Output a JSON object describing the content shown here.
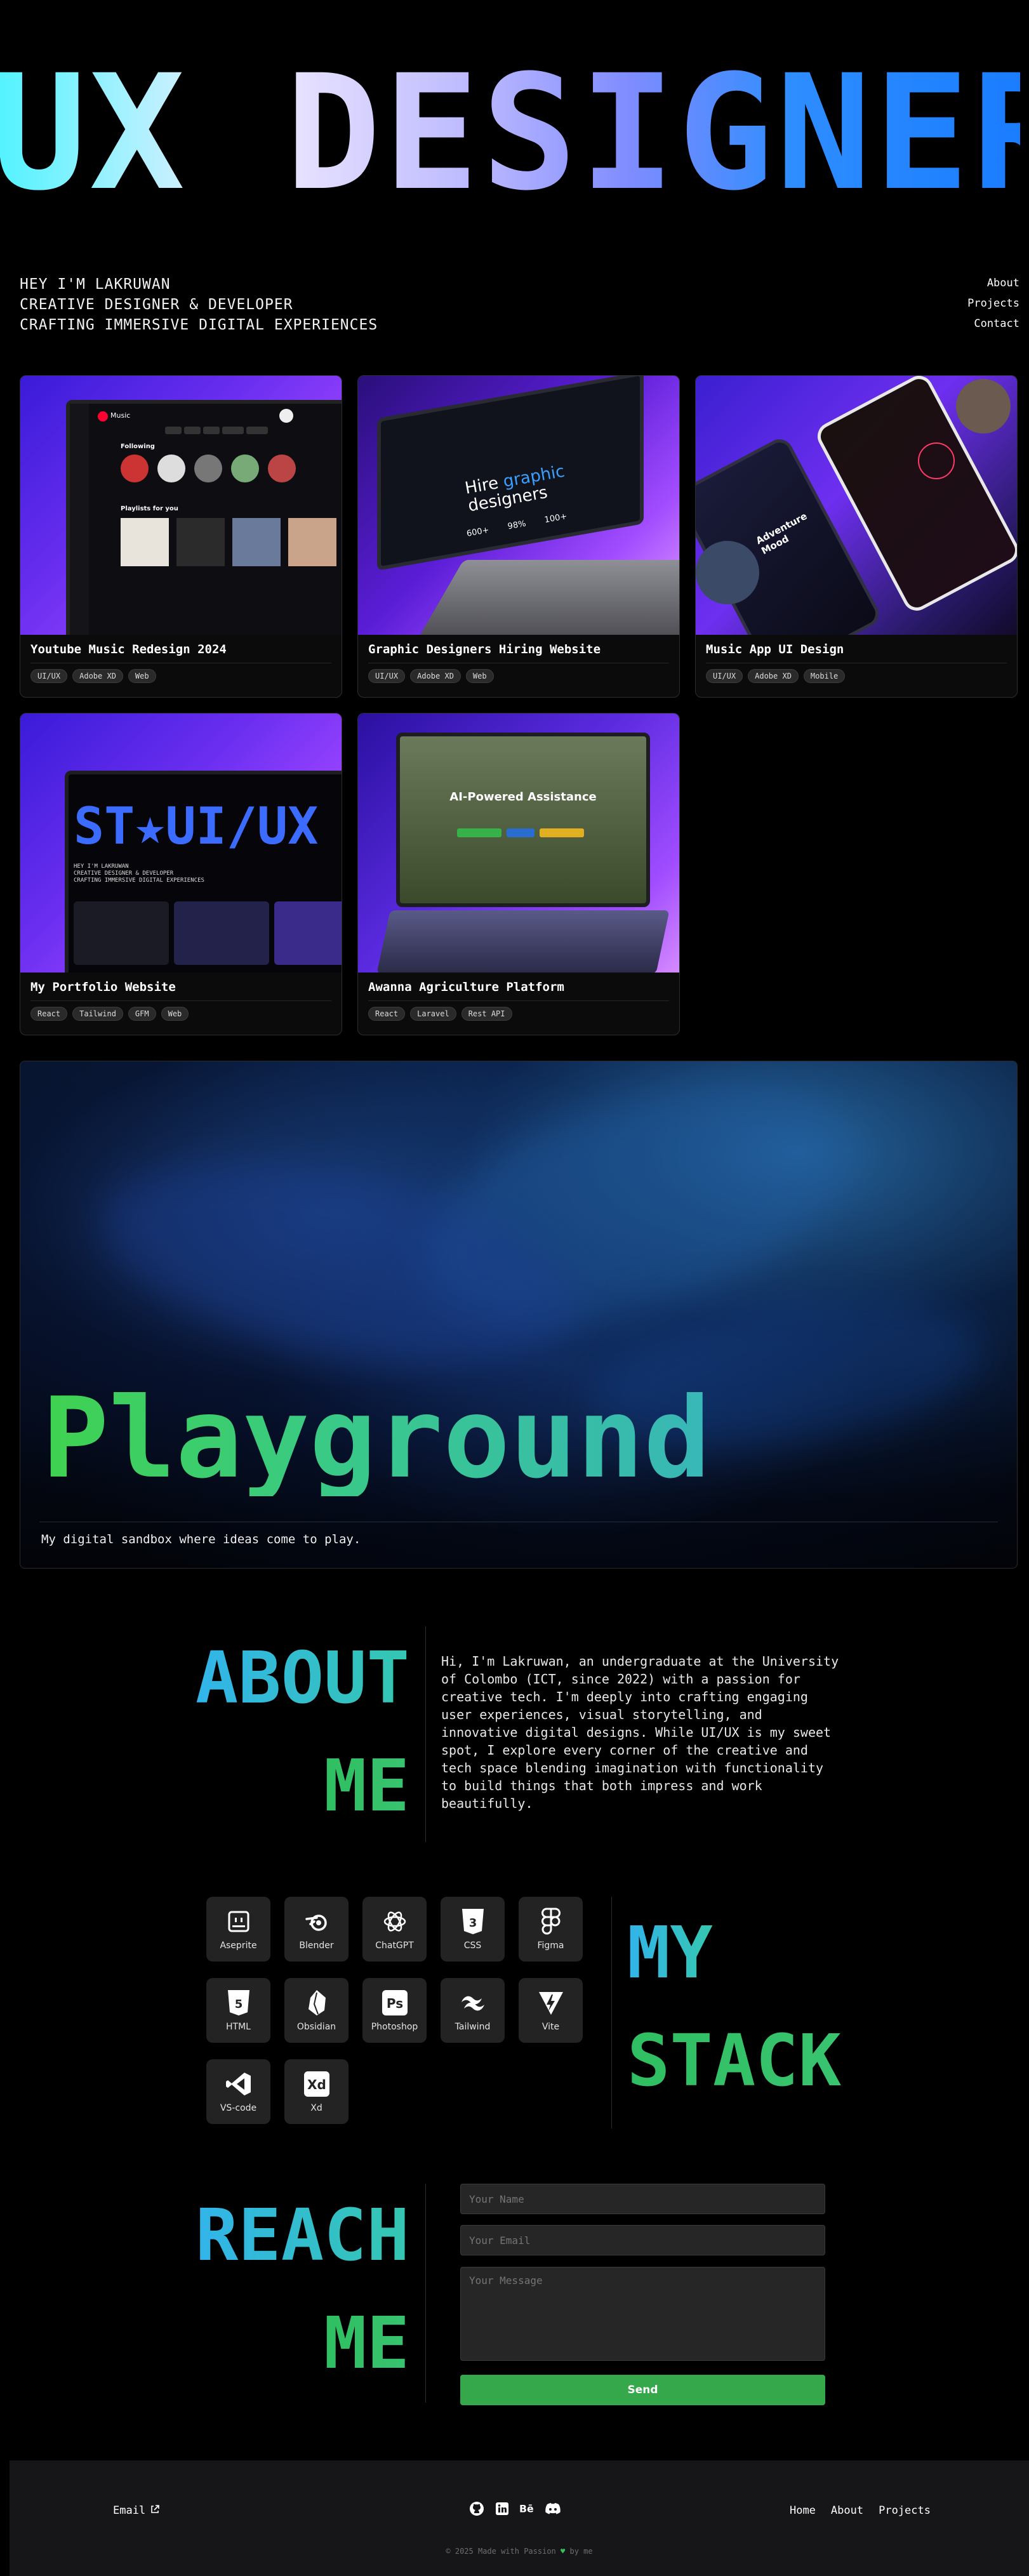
{
  "hero": {
    "title": "UX_DESIGNER",
    "intro": [
      "HEY I'M LAKRUWAN",
      "CREATIVE DESIGNER & DEVELOPER",
      "CRAFTING IMMERSIVE DIGITAL EXPERIENCES"
    ]
  },
  "nav": {
    "items": [
      "About",
      "Projects",
      "Contact"
    ]
  },
  "projects": [
    {
      "title": "Youtube Music Redesign 2024",
      "tags": [
        "UI/UX",
        "Adobe XD",
        "Web"
      ]
    },
    {
      "title": "Graphic Designers Hiring Website",
      "tags": [
        "UI/UX",
        "Adobe XD",
        "Web"
      ]
    },
    {
      "title": "Music App UI Design",
      "tags": [
        "UI/UX",
        "Adobe XD",
        "Mobile"
      ]
    },
    {
      "title": "My Portfolio Website",
      "tags": [
        "React",
        "Tailwind",
        "GFM",
        "Web"
      ]
    },
    {
      "title": "Awanna Agriculture Platform",
      "tags": [
        "React",
        "Laravel",
        "Rest API"
      ]
    }
  ],
  "mockups": {
    "music_app_name": "Music",
    "following": "Following",
    "playlists": "Playlists for you",
    "hire_line1": "Hire",
    "hire_accent": "graphic",
    "hire_line2": "designers",
    "hire_stats": [
      "600+",
      "98%",
      "100+"
    ],
    "phone_title": "Adventure Mood",
    "portfolio_mark": "ST★UI/UX",
    "portfolio_lines": [
      "HEY I'M LAKRUWAN",
      "CREATIVE DESIGNER & DEVELOPER",
      "CRAFTING IMMERSIVE DIGITAL EXPERIENCES"
    ],
    "agri_title": "AI-Powered Assistance"
  },
  "playground": {
    "title": "Playground",
    "subtitle": "My digital sandbox where ideas come to play."
  },
  "about": {
    "heading_line1": "ABOUT",
    "heading_line2": "ME",
    "body": "Hi, I'm Lakruwan, an undergraduate at the University of Colombo (ICT, since 2022) with a passion for creative tech. I'm deeply into crafting engaging user experiences, visual storytelling, and innovative digital designs. While UI/UX is my sweet spot, I explore every corner of the creative and tech space blending imagination with functionality to build things that both impress and work beautifully."
  },
  "stack": {
    "heading_line1": "MY",
    "heading_line2": "STACK",
    "tools": [
      {
        "name": "Aseprite",
        "icon": "aseprite-icon"
      },
      {
        "name": "Blender",
        "icon": "blender-icon"
      },
      {
        "name": "ChatGPT",
        "icon": "chatgpt-icon"
      },
      {
        "name": "CSS",
        "icon": "css-icon"
      },
      {
        "name": "Figma",
        "icon": "figma-icon"
      },
      {
        "name": "HTML",
        "icon": "html-icon"
      },
      {
        "name": "Obsidian",
        "icon": "obsidian-icon"
      },
      {
        "name": "Photoshop",
        "icon": "photoshop-icon"
      },
      {
        "name": "Tailwind",
        "icon": "tailwind-icon"
      },
      {
        "name": "Vite",
        "icon": "vite-icon"
      },
      {
        "name": "VS-code",
        "icon": "vscode-icon"
      },
      {
        "name": "Xd",
        "icon": "xd-icon"
      }
    ]
  },
  "reach": {
    "heading_line1": "REACH",
    "heading_line2": "ME",
    "name_placeholder": "Your Name",
    "email_placeholder": "Your Email",
    "message_placeholder": "Your Message",
    "send_label": "Send"
  },
  "footer": {
    "email_label": "Email",
    "social_icons": [
      "github-icon",
      "linkedin-icon",
      "behance-icon",
      "discord-icon"
    ],
    "links": [
      "Home",
      "About",
      "Projects"
    ],
    "copy_prefix": "© 2025 Made with Passion",
    "copy_suffix": "by me"
  },
  "colors": {
    "accent_green": "#35a84c",
    "accent_cyan": "#32b4ea",
    "card_purple": "#6a2ef0"
  }
}
